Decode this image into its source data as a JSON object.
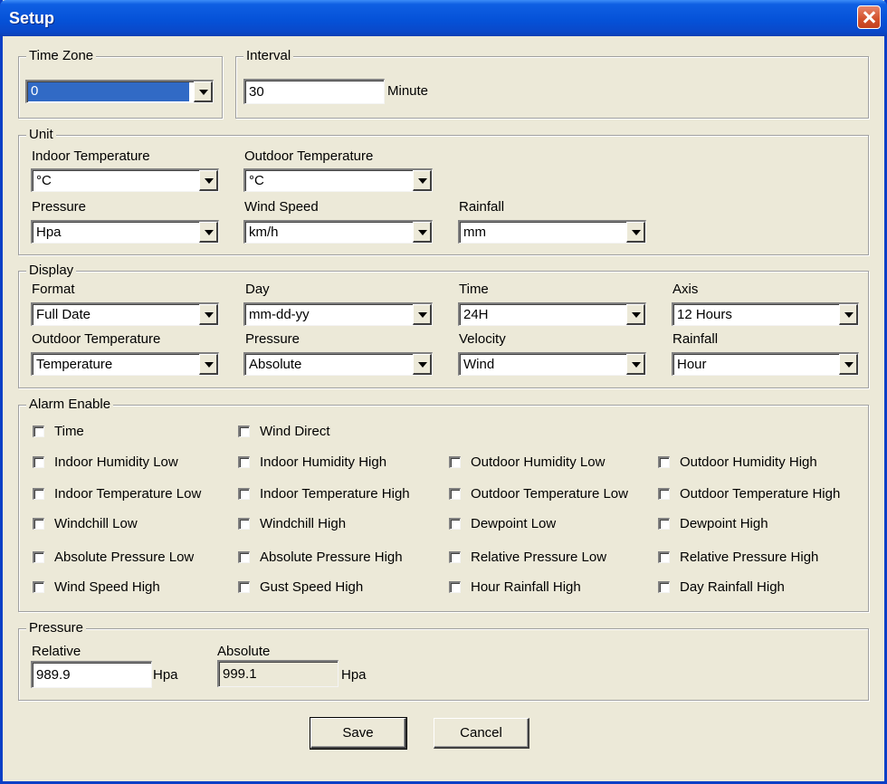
{
  "window": {
    "title": "Setup"
  },
  "time_zone": {
    "legend": "Time Zone",
    "value": "0"
  },
  "interval": {
    "legend": "Interval",
    "value": "30",
    "unit": "Minute"
  },
  "unit": {
    "legend": "Unit",
    "indoor_temperature": {
      "label": "Indoor Temperature",
      "value": "°C"
    },
    "outdoor_temperature": {
      "label": "Outdoor Temperature",
      "value": "°C"
    },
    "pressure": {
      "label": "Pressure",
      "value": "Hpa"
    },
    "wind_speed": {
      "label": "Wind Speed",
      "value": "km/h"
    },
    "rainfall": {
      "label": "Rainfall",
      "value": "mm"
    }
  },
  "display": {
    "legend": "Display",
    "format": {
      "label": "Format",
      "value": "Full Date"
    },
    "day": {
      "label": "Day",
      "value": "mm-dd-yy"
    },
    "time": {
      "label": "Time",
      "value": "24H"
    },
    "axis": {
      "label": "Axis",
      "value": "12 Hours"
    },
    "outdoor_temperature": {
      "label": "Outdoor Temperature",
      "value": "Temperature"
    },
    "pressure": {
      "label": "Pressure",
      "value": "Absolute"
    },
    "velocity": {
      "label": "Velocity",
      "value": "Wind"
    },
    "rainfall": {
      "label": "Rainfall",
      "value": "Hour"
    }
  },
  "alarm": {
    "legend": "Alarm Enable",
    "items": [
      "Time",
      "Wind Direct",
      "Indoor Humidity Low",
      "Indoor Humidity High",
      "Outdoor Humidity Low",
      "Outdoor Humidity High",
      "Indoor Temperature Low",
      "Indoor Temperature High",
      "Outdoor Temperature Low",
      "Outdoor Temperature High",
      "Windchill Low",
      "Windchill High",
      "Dewpoint Low",
      "Dewpoint High",
      "Absolute Pressure Low",
      "Absolute Pressure High",
      "Relative Pressure Low",
      "Relative Pressure High",
      "Wind Speed High",
      "Gust Speed High",
      "Hour Rainfall High",
      "Day Rainfall High"
    ]
  },
  "pressure": {
    "legend": "Pressure",
    "relative": {
      "label": "Relative",
      "value": "989.9",
      "unit": "Hpa"
    },
    "absolute": {
      "label": "Absolute",
      "value": "999.1",
      "unit": "Hpa"
    }
  },
  "buttons": {
    "save": "Save",
    "cancel": "Cancel"
  }
}
